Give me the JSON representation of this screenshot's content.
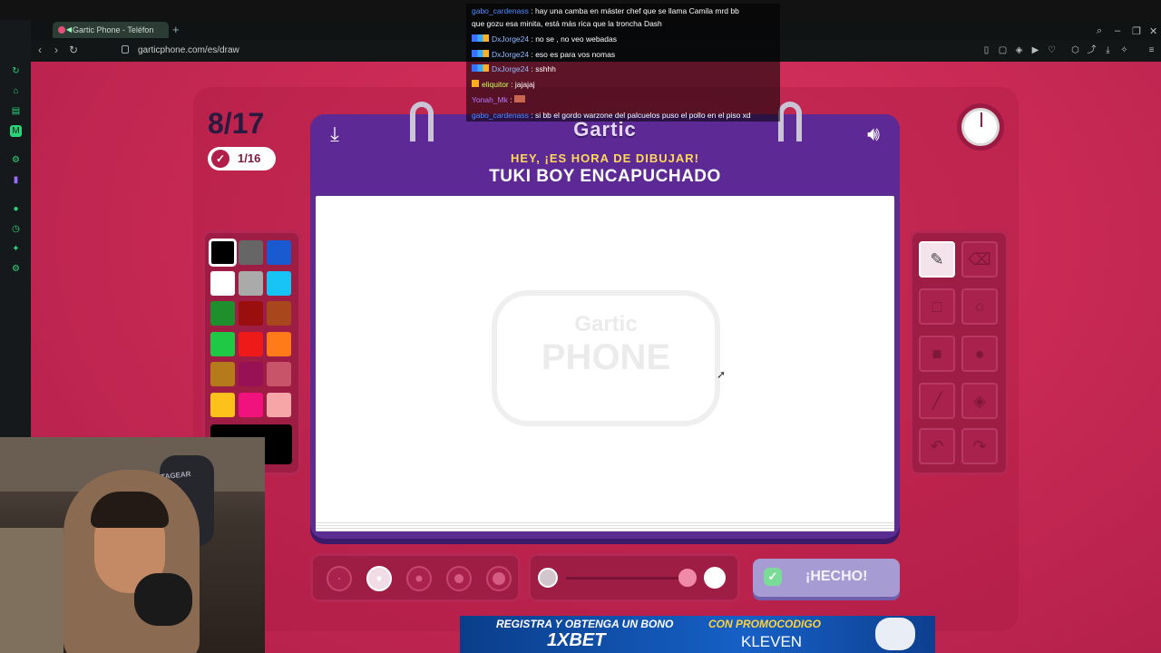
{
  "browser": {
    "tab_title": "Gartic Phone - Teléfon",
    "url": "garticphone.com/es/draw",
    "new_tab": "+"
  },
  "game": {
    "round": "8/17",
    "done_count": "1/16",
    "logo": "Gartic",
    "heading": "HEY, ¡ES HORA DE DIBUJAR!",
    "prompt_word": "TUKI BOY ENCAPUCHADO",
    "watermark_top": "Gartic",
    "watermark_bottom": "PHONE",
    "done_button": "¡HECHO!",
    "palette": [
      {
        "name": "black",
        "color": "#000000",
        "selected": true
      },
      {
        "name": "gray",
        "color": "#666666"
      },
      {
        "name": "blue",
        "color": "#1a5ad0"
      },
      {
        "name": "white",
        "color": "#ffffff"
      },
      {
        "name": "light-gray",
        "color": "#aaaaaa"
      },
      {
        "name": "cyan",
        "color": "#17c4f5"
      },
      {
        "name": "dark-green",
        "color": "#1f8f2e"
      },
      {
        "name": "dark-red",
        "color": "#9b0e0e"
      },
      {
        "name": "brown",
        "color": "#a8461c"
      },
      {
        "name": "green",
        "color": "#20c945"
      },
      {
        "name": "red",
        "color": "#ee1a1a"
      },
      {
        "name": "orange",
        "color": "#ff7a18"
      },
      {
        "name": "ochre",
        "color": "#b57a1c"
      },
      {
        "name": "maroon",
        "color": "#991155"
      },
      {
        "name": "rose",
        "color": "#c8546a"
      },
      {
        "name": "yellow",
        "color": "#fcc11b"
      },
      {
        "name": "pink",
        "color": "#f0137e"
      },
      {
        "name": "light-pink",
        "color": "#f7a6a8"
      }
    ],
    "selected_brush_size_index": 1,
    "opacity_value": 1
  },
  "chat": [
    {
      "user": "gabo_cardenass",
      "text": "hay una camba en máster chef que se llama Camila mrd bb"
    },
    {
      "user": "",
      "text": "que gozu esa minita, está más rica que la troncha Dash"
    },
    {
      "user": "DxJorge24",
      "text": "no se , no veo webadas"
    },
    {
      "user": "DxJorge24",
      "text": "eso es para vos nomas"
    },
    {
      "user": "DxJorge24",
      "text": "sshhh"
    },
    {
      "user": "eliquitor",
      "text": "jajajaj"
    },
    {
      "user": "Yonah_Mk",
      "text": ""
    },
    {
      "user": "gabo_cardenass",
      "text": "si bb el gordo warzone del palcuelos puso el pollo en el piso xd"
    }
  ],
  "webcam": {
    "chair_brand": "STAGEAR"
  },
  "ad": {
    "line1": "REGISTRA Y OBTENGA UN BONO",
    "brand": "1XBET",
    "promo_label": "CON PROMOCODIGO",
    "promo_code": "KLEVEN"
  },
  "colors": {
    "page": "#c92a55",
    "board": "#5b2d91",
    "accent": "#ffd95a",
    "done": "#a79bd3"
  }
}
